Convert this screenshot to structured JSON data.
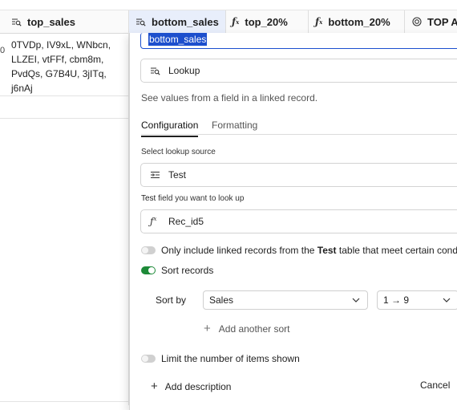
{
  "grid": {
    "columns": [
      {
        "label": "top_sales",
        "icon": "lookup-icon"
      },
      {
        "label": "bottom_sales",
        "icon": "lookup-icon"
      },
      {
        "label": "top_20%",
        "icon": "formula-icon"
      },
      {
        "label": "bottom_20%",
        "icon": "formula-icon"
      },
      {
        "label": "TOP Av",
        "icon": "rollup-icon"
      }
    ],
    "row_number": "0",
    "row_cell_text": "0TVDp, IV9xL, WNbcn, LLZEI, vtFFf, cbm8m, PvdQs, G7B4U, 3jITq, j6nAj"
  },
  "dialog": {
    "field_name": "bottom_sales",
    "field_type": "Lookup",
    "field_type_desc": "See values from a field in a linked record.",
    "tabs": [
      {
        "label": "Configuration",
        "active": true
      },
      {
        "label": "Formatting",
        "active": false
      }
    ],
    "lookup_source_label": "Select lookup source",
    "lookup_source_value": "Test",
    "lookup_field_label_prefix": "Test",
    "lookup_field_label_rest": " field you want to look up",
    "lookup_field_value": "Rec_id5",
    "filter_option": {
      "prefix": "Only include linked records from the ",
      "table": "Test",
      "suffix": " table that meet certain condit",
      "enabled": false
    },
    "sort_option": {
      "label": "Sort records",
      "enabled": true
    },
    "sort_by_label": "Sort by",
    "sort_field": "Sales",
    "sort_direction": "1 → 9",
    "add_sort_label": "Add another sort",
    "limit_option": {
      "label": "Limit the number of items shown",
      "enabled": false
    },
    "add_description_label": "Add description",
    "cancel_label": "Cancel"
  },
  "colors": {
    "accent_blue": "#1d4fcd",
    "toggle_on": "#1d8a38",
    "active_header_bg": "#e8eefb"
  }
}
